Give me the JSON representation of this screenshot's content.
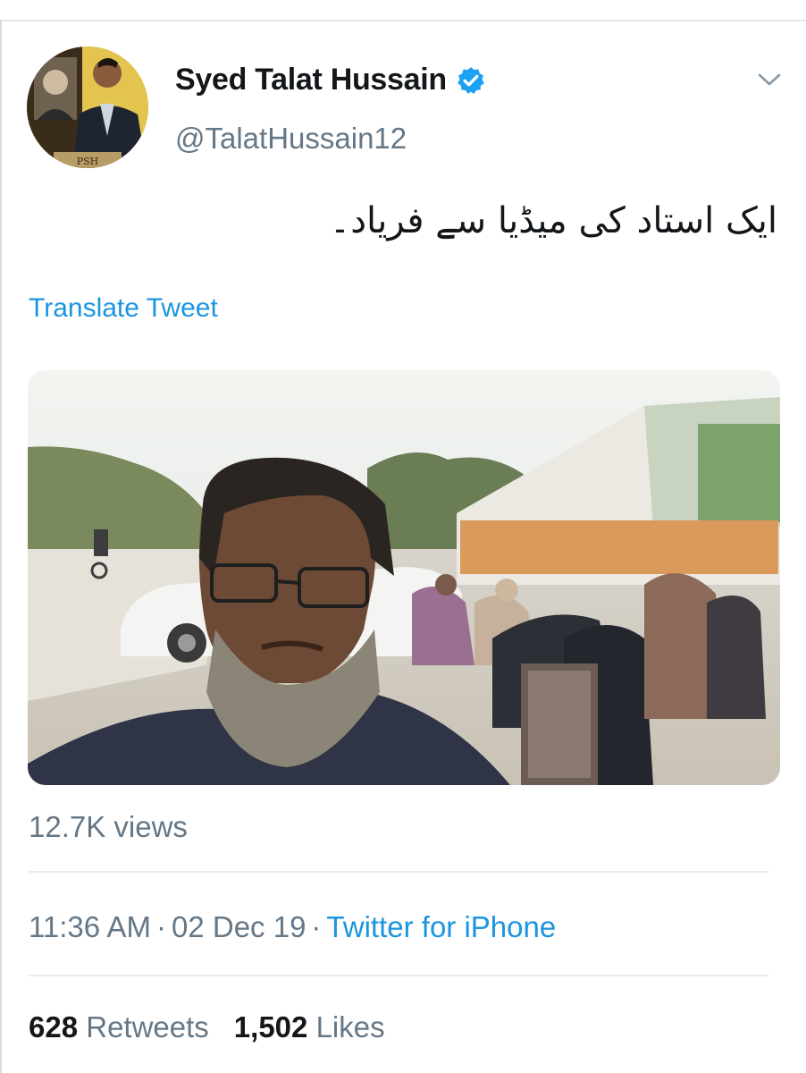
{
  "author": {
    "display_name": "Syed Talat Hussain",
    "handle": "@TalatHussain12",
    "verified_icon": "verified-badge-icon",
    "avatar_caption": "PSH"
  },
  "menu": {
    "icon": "chevron-down-icon"
  },
  "tweet": {
    "text": "ایک استاد کی میڈیا سے فریاد۔",
    "translate_label": "Translate Tweet"
  },
  "media": {
    "type": "video-thumbnail"
  },
  "views": "12.7K views",
  "meta": {
    "time": "11:36 AM",
    "separator": "·",
    "date": "02 Dec 19",
    "source": "Twitter for iPhone"
  },
  "stats": {
    "retweets_count": "628",
    "retweets_label": "Retweets",
    "likes_count": "1,502",
    "likes_label": "Likes"
  },
  "colors": {
    "link": "#1b95e0",
    "secondary_text": "#657786",
    "primary_text": "#14171a",
    "divider": "#e6ecf0"
  }
}
